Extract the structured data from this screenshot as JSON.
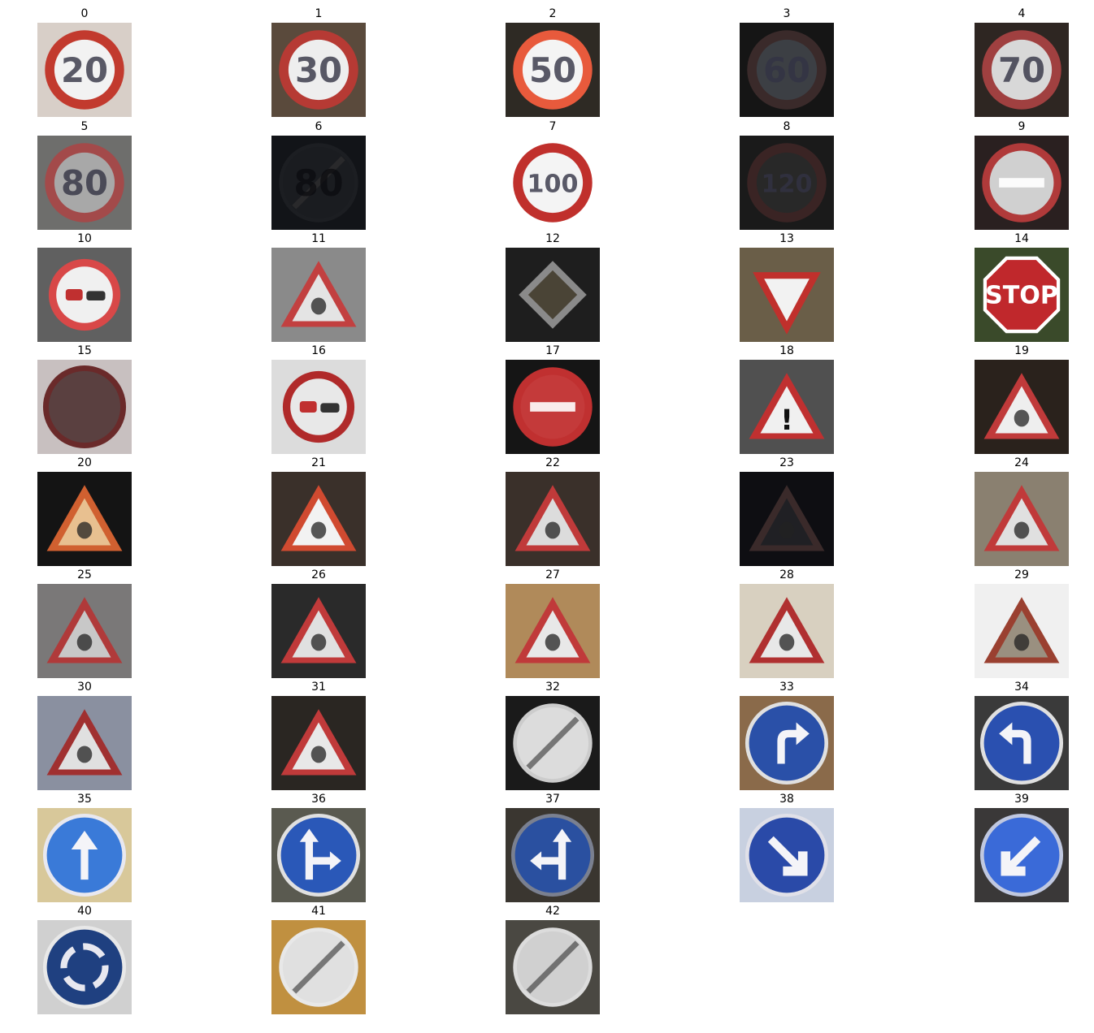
{
  "grid": {
    "signs": [
      {
        "label": "0",
        "kind": "speed",
        "text": "20",
        "bg": "#d8cfc8",
        "ring": "#c23a2e",
        "fill": "#f2f2f2"
      },
      {
        "label": "1",
        "kind": "speed",
        "text": "30",
        "bg": "#5a4a3c",
        "ring": "#b63a34",
        "fill": "#eeeeee"
      },
      {
        "label": "2",
        "kind": "speed",
        "text": "50",
        "bg": "#2e2a24",
        "ring": "#e85a3c",
        "fill": "#f4f4f4"
      },
      {
        "label": "3",
        "kind": "speed",
        "text": "60",
        "bg": "#151515",
        "ring": "#3a2a2a",
        "fill": "#3c3f44"
      },
      {
        "label": "4",
        "kind": "speed",
        "text": "70",
        "bg": "#2e2622",
        "ring": "#a04040",
        "fill": "#d8d8d8"
      },
      {
        "label": "5",
        "kind": "speed",
        "text": "80",
        "bg": "#6e6e6c",
        "ring": "#a34a4a",
        "fill": "#a8a8a8"
      },
      {
        "label": "6",
        "kind": "derestrict",
        "text": "80",
        "bg": "#121418",
        "ring": "#1c1e22",
        "fill": "#1a1c20"
      },
      {
        "label": "7",
        "kind": "speed",
        "text": "100",
        "bg": "#ffffff",
        "ring": "#c0302c",
        "fill": "#f4f4f4"
      },
      {
        "label": "8",
        "kind": "speed",
        "text": "120",
        "bg": "#1a1a1a",
        "ring": "#3a2424",
        "fill": "#282828"
      },
      {
        "label": "9",
        "kind": "noentry",
        "text": "",
        "bg": "#2a2020",
        "ring": "#b03a3a",
        "fill": "#d0d0d0"
      },
      {
        "label": "10",
        "kind": "noovertake",
        "text": "",
        "bg": "#606060",
        "ring": "#d84848",
        "fill": "#f0f0f0"
      },
      {
        "label": "11",
        "kind": "triangle",
        "text": "",
        "bg": "#8a8a8a",
        "ring": "#c24040",
        "fill": "#e4e4e4"
      },
      {
        "label": "12",
        "kind": "priority",
        "text": "",
        "bg": "#1e1e1e",
        "ring": "#3a3a3a",
        "fill": "#4a4436"
      },
      {
        "label": "13",
        "kind": "yield",
        "text": "",
        "bg": "#6a5e48",
        "ring": "#c0302c",
        "fill": "#f2f2f2"
      },
      {
        "label": "14",
        "kind": "stop",
        "text": "STOP",
        "bg": "#3a4a2a",
        "ring": "#ffffff",
        "fill": "#c0282c"
      },
      {
        "label": "15",
        "kind": "blank",
        "text": "",
        "bg": "#c8c0c0",
        "ring": "#6a2a2a",
        "fill": "#5a4040"
      },
      {
        "label": "16",
        "kind": "noovertake",
        "text": "",
        "bg": "#dcdcdc",
        "ring": "#b02a2a",
        "fill": "#e8e8e8"
      },
      {
        "label": "17",
        "kind": "noentry",
        "text": "",
        "bg": "#151515",
        "ring": "#c03030",
        "fill": "#c43a3a"
      },
      {
        "label": "18",
        "kind": "triangle",
        "text": "!",
        "bg": "#505050",
        "ring": "#c03030",
        "fill": "#f0f0f0"
      },
      {
        "label": "19",
        "kind": "triangle",
        "text": "",
        "bg": "#2a221c",
        "ring": "#c03a3a",
        "fill": "#eeeeee"
      },
      {
        "label": "20",
        "kind": "triangle",
        "text": "",
        "bg": "#141414",
        "ring": "#d06030",
        "fill": "#e8c090"
      },
      {
        "label": "21",
        "kind": "triangle",
        "text": "",
        "bg": "#3a302a",
        "ring": "#d04a30",
        "fill": "#f2f2f2"
      },
      {
        "label": "22",
        "kind": "triangle",
        "text": "",
        "bg": "#3a302a",
        "ring": "#c03a3a",
        "fill": "#dcdcdc"
      },
      {
        "label": "23",
        "kind": "triangle",
        "text": "",
        "bg": "#0e0e12",
        "ring": "#3a2a2a",
        "fill": "#202024"
      },
      {
        "label": "24",
        "kind": "triangle",
        "text": "",
        "bg": "#8a8070",
        "ring": "#c03a3a",
        "fill": "#e0e0e0"
      },
      {
        "label": "25",
        "kind": "triangle",
        "text": "",
        "bg": "#7a7878",
        "ring": "#b03a3a",
        "fill": "#c8c8c8"
      },
      {
        "label": "26",
        "kind": "triangle",
        "text": "",
        "bg": "#2a2a2a",
        "ring": "#c03a3a",
        "fill": "#e0e0e0"
      },
      {
        "label": "27",
        "kind": "triangle",
        "text": "",
        "bg": "#b08a5a",
        "ring": "#c03a3a",
        "fill": "#e8e8e8"
      },
      {
        "label": "28",
        "kind": "triangle",
        "text": "",
        "bg": "#d8d0c0",
        "ring": "#b03030",
        "fill": "#e8e8e8"
      },
      {
        "label": "29",
        "kind": "triangle",
        "text": "",
        "bg": "#f0f0f0",
        "ring": "#9a4030",
        "fill": "#9a9080"
      },
      {
        "label": "30",
        "kind": "triangle",
        "text": "",
        "bg": "#8a90a0",
        "ring": "#a03030",
        "fill": "#e0e0e0"
      },
      {
        "label": "31",
        "kind": "triangle",
        "text": "",
        "bg": "#2a2622",
        "ring": "#c03a3a",
        "fill": "#e8e8e8"
      },
      {
        "label": "32",
        "kind": "derestrict",
        "text": "",
        "bg": "#1a1a1a",
        "ring": "#cccccc",
        "fill": "#dcdcdc"
      },
      {
        "label": "33",
        "kind": "blue",
        "text": "right",
        "bg": "#8a6a4a",
        "ring": "#e0e0e0",
        "fill": "#2a50a8"
      },
      {
        "label": "34",
        "kind": "blue",
        "text": "left",
        "bg": "#3a3a3a",
        "ring": "#e0e0e0",
        "fill": "#2a50b0"
      },
      {
        "label": "35",
        "kind": "blue",
        "text": "up",
        "bg": "#d8c89a",
        "ring": "#e8e8f0",
        "fill": "#3a7ad8"
      },
      {
        "label": "36",
        "kind": "blue",
        "text": "upright",
        "bg": "#5a5a50",
        "ring": "#e0e0e0",
        "fill": "#2a58b8"
      },
      {
        "label": "37",
        "kind": "blue",
        "text": "upleft",
        "bg": "#3a3630",
        "ring": "#7a8090",
        "fill": "#2a50a0"
      },
      {
        "label": "38",
        "kind": "blue",
        "text": "downright",
        "bg": "#c8d0e0",
        "ring": "#e0e0e8",
        "fill": "#2a4aa8"
      },
      {
        "label": "39",
        "kind": "blue",
        "text": "downleft",
        "bg": "#3a3838",
        "ring": "#c0c8e0",
        "fill": "#3a6ad8"
      },
      {
        "label": "40",
        "kind": "blue",
        "text": "round",
        "bg": "#d0d0d0",
        "ring": "#e8e8e8",
        "fill": "#1f4080"
      },
      {
        "label": "41",
        "kind": "derestrict",
        "text": "",
        "bg": "#c09040",
        "ring": "#e8e8e8",
        "fill": "#e0e0e0"
      },
      {
        "label": "42",
        "kind": "derestrict",
        "text": "",
        "bg": "#4a4842",
        "ring": "#dcdcdc",
        "fill": "#d0d0d0"
      }
    ]
  }
}
